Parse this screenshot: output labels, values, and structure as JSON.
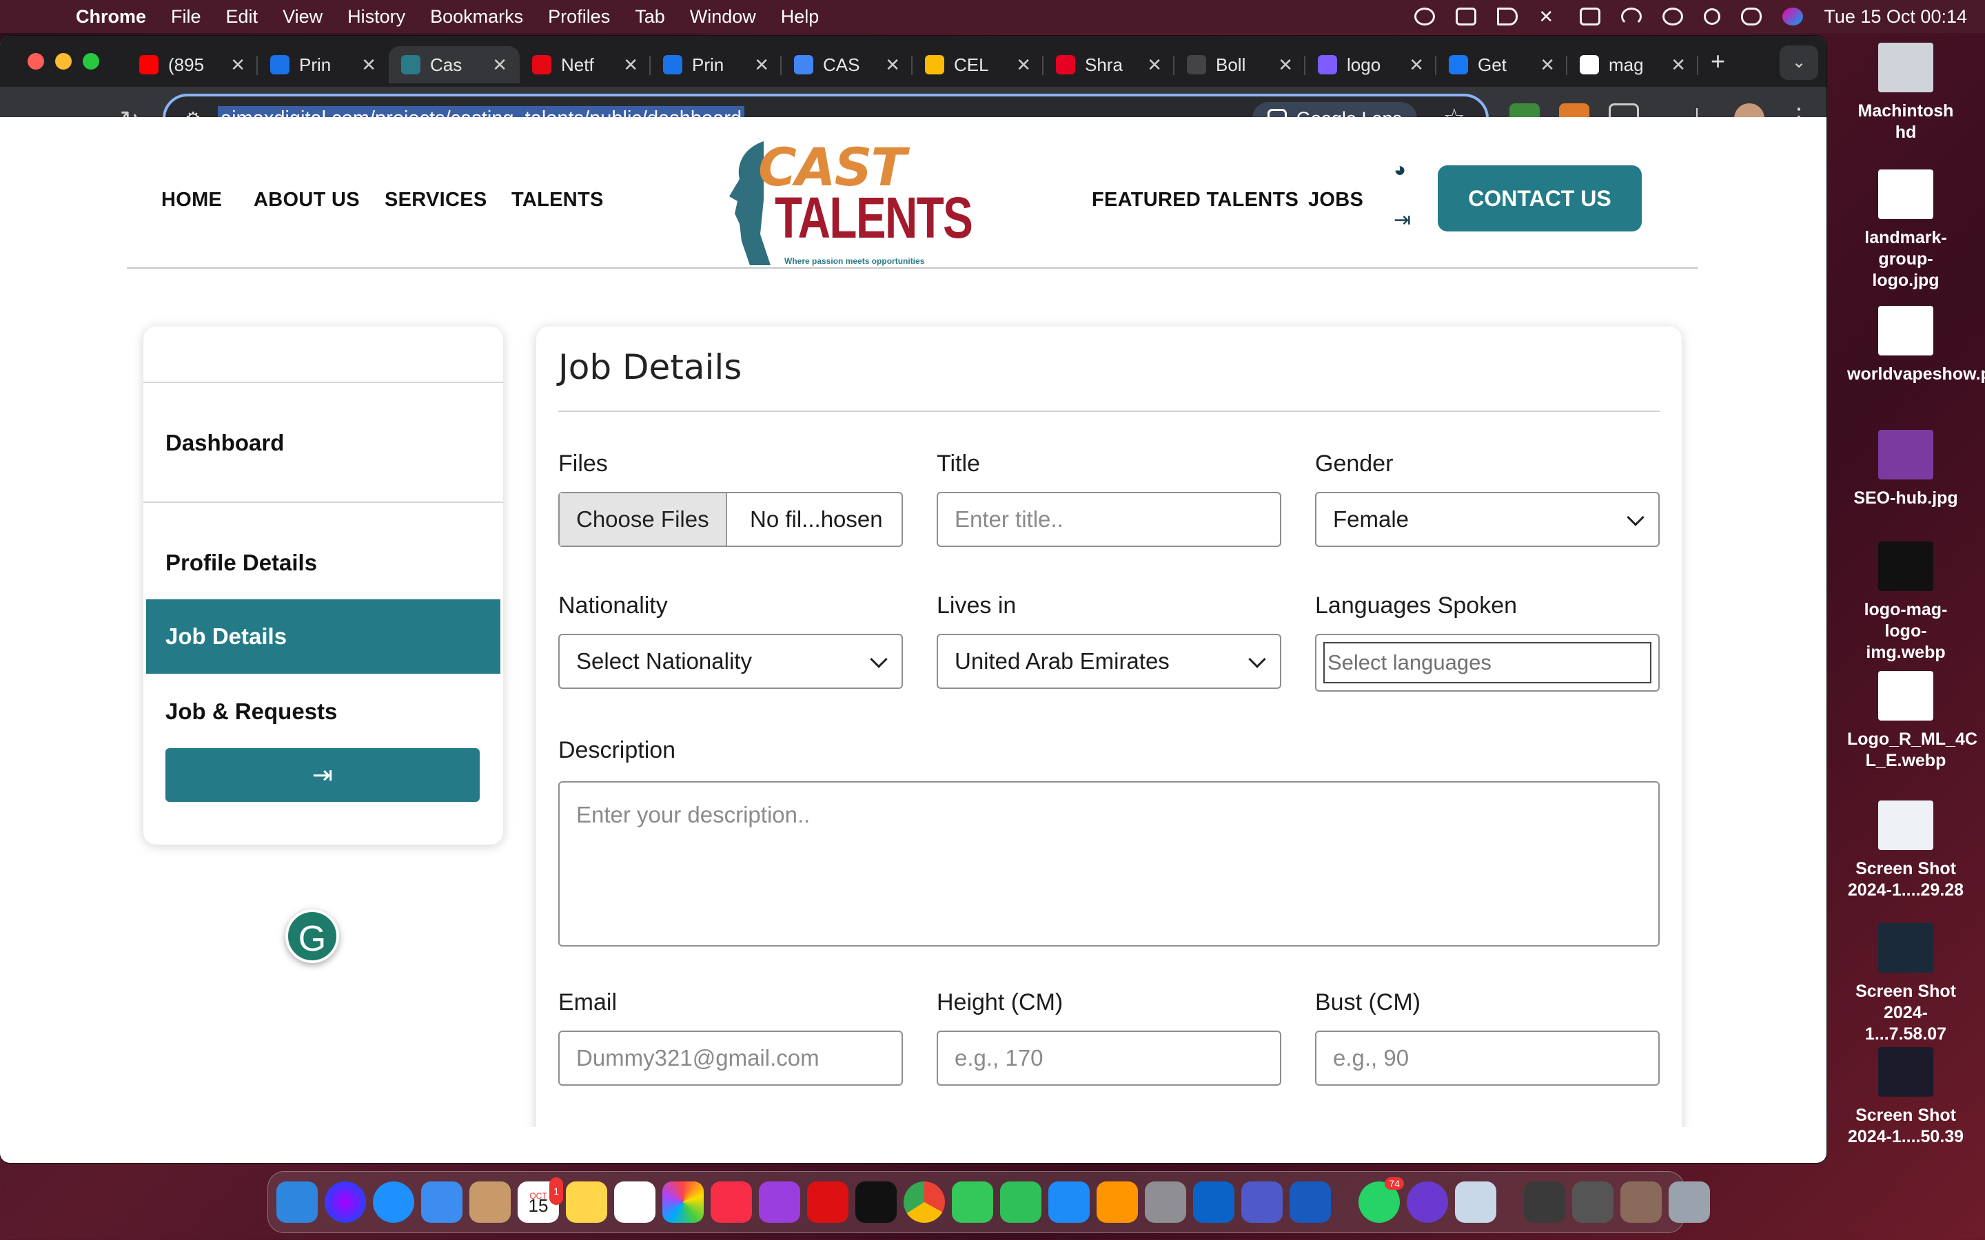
{
  "menubar": {
    "app": "Chrome",
    "items": [
      "File",
      "Edit",
      "View",
      "History",
      "Bookmarks",
      "Profiles",
      "Tab",
      "Window",
      "Help"
    ],
    "clock": "Tue 15 Oct  00:14"
  },
  "tabs": [
    {
      "label": "(895",
      "color": "#ff0000"
    },
    {
      "label": "Prin",
      "color": "#1a73e8"
    },
    {
      "label": "Cas",
      "color": "#2a7a88"
    },
    {
      "label": "Netf",
      "color": "#e50914"
    },
    {
      "label": "Prin",
      "color": "#1a73e8"
    },
    {
      "label": "CAS",
      "color": "#4285f4"
    },
    {
      "label": "CEL",
      "color": "#fbbc04"
    },
    {
      "label": "Shra",
      "color": "#e60023"
    },
    {
      "label": "Boll",
      "color": "#444444"
    },
    {
      "label": "logo",
      "color": "#7b5cff"
    },
    {
      "label": "Get",
      "color": "#1877f2"
    },
    {
      "label": "mag",
      "color": "#ffffff"
    }
  ],
  "address": {
    "url": "aimaxdigital.com/projects/casting_talents/public/dashboard",
    "lens": "Google Lens"
  },
  "site": {
    "nav_left": [
      "HOME",
      "ABOUT US",
      "SERVICES",
      "TALENTS"
    ],
    "nav_right": [
      "FEATURED TALENTS",
      "JOBS"
    ],
    "logo": {
      "cast": "CAST",
      "talents": "TALENTS",
      "tagline": "Where passion meets opportunities"
    },
    "contact": "CONTACT US"
  },
  "sidebar": {
    "dashboard": "Dashboard",
    "profile": "Profile Details",
    "job_details": "Job Details",
    "jobs_requests": "Job & Requests"
  },
  "form": {
    "title": "Job Details",
    "files": {
      "label": "Files",
      "button": "Choose Files",
      "status": "No fil...hosen"
    },
    "title_field": {
      "label": "Title",
      "placeholder": "Enter title.."
    },
    "gender": {
      "label": "Gender",
      "value": "Female"
    },
    "nationality": {
      "label": "Nationality",
      "value": "Select Nationality"
    },
    "lives_in": {
      "label": "Lives in",
      "value": "United Arab Emirates"
    },
    "languages": {
      "label": "Languages Spoken",
      "placeholder": "Select languages"
    },
    "description": {
      "label": "Description",
      "placeholder": "Enter your description.."
    },
    "email": {
      "label": "Email",
      "placeholder": "Dummy321@gmail.com"
    },
    "height": {
      "label": "Height (CM)",
      "placeholder": "e.g., 170"
    },
    "bust": {
      "label": "Bust (CM)",
      "placeholder": "e.g., 90"
    }
  },
  "desktop": [
    {
      "label": "Machintosh hd"
    },
    {
      "label": "landmark-group-logo.jpg"
    },
    {
      "label": "worldvapeshow.png"
    },
    {
      "label": "SEO-hub.jpg"
    },
    {
      "label": "logo-mag-logo-img.webp"
    },
    {
      "label": "Logo_R_ML_4C L_E.webp"
    },
    {
      "label": "Screen Shot 2024-1....29.28"
    },
    {
      "label": "Screen Shot 2024-1...7.58.07"
    },
    {
      "label": "Screen Shot 2024-1....50.39"
    }
  ],
  "dock": {
    "calendar_day": "15",
    "calendar_month": "OCT",
    "calendar_badge": "1",
    "whatsapp_badge": "74"
  }
}
